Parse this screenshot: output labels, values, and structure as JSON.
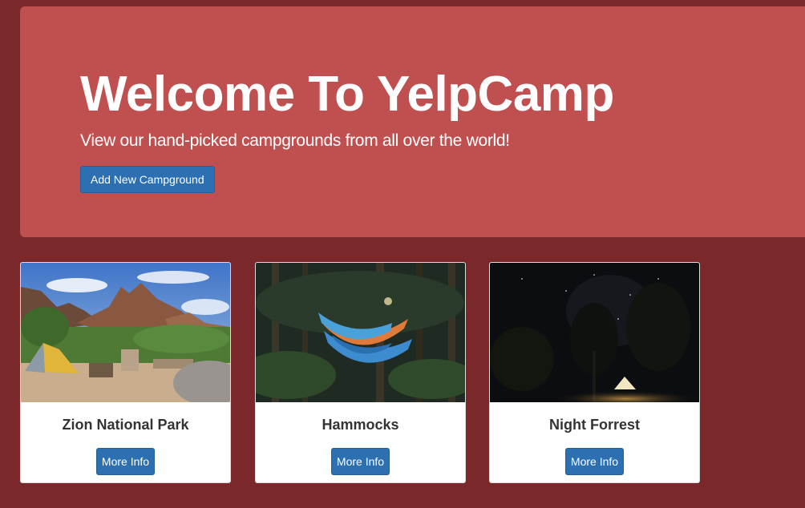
{
  "header": {
    "title": "Welcome To YelpCamp",
    "subtitle": "View our hand-picked campgrounds from all over the world!",
    "add_button_label": "Add New Campground"
  },
  "campgrounds": [
    {
      "name": "Zion National Park",
      "button_label": "More Info",
      "image": "zion-photo"
    },
    {
      "name": "Hammocks",
      "button_label": "More Info",
      "image": "hammocks-photo"
    },
    {
      "name": "Night Forrest",
      "button_label": "More Info",
      "image": "night-forest-photo"
    }
  ],
  "colors": {
    "page_bg": "#7b282b",
    "jumbotron_bg": "#c05050",
    "button_primary": "#2c70b2",
    "card_bg": "#ffffff"
  }
}
